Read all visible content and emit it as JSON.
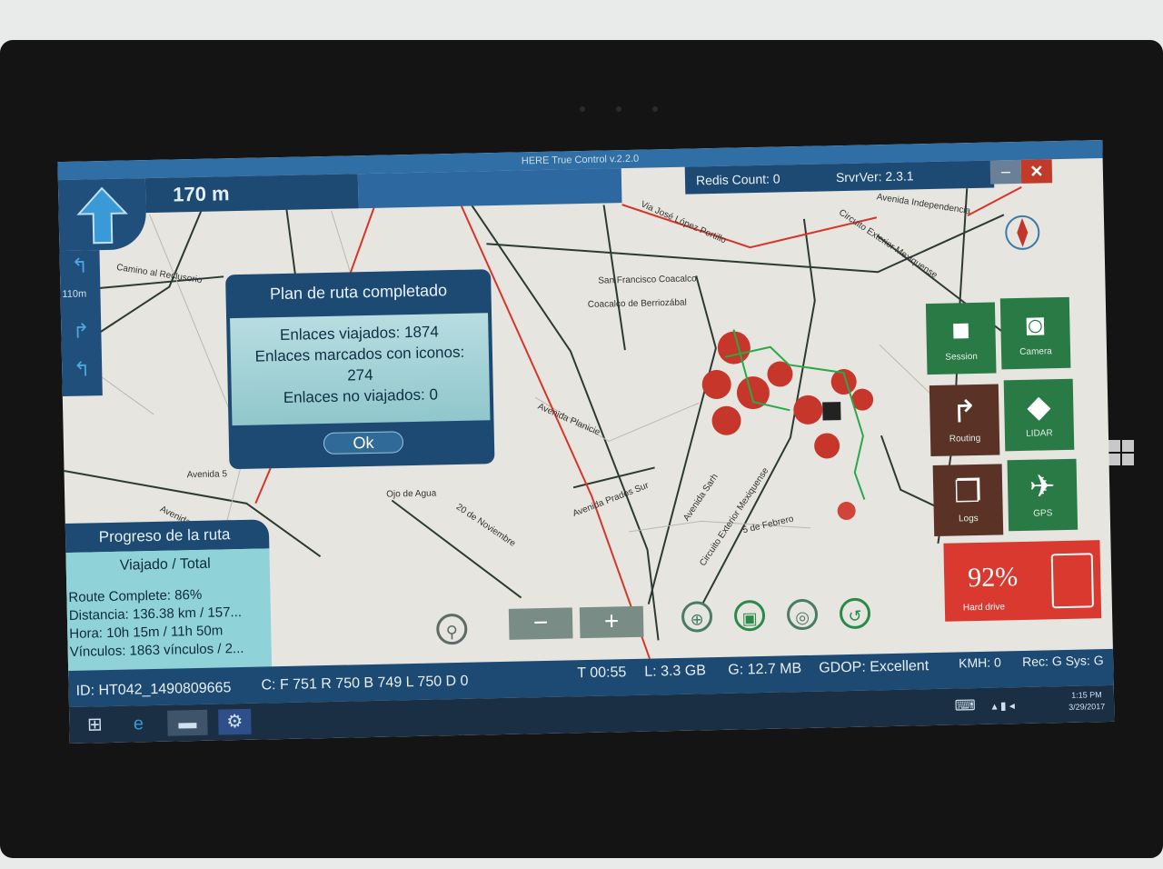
{
  "app": {
    "title": "HERE True Control v.2.2.0"
  },
  "nav": {
    "distance": "170 m",
    "next_distance": "110m"
  },
  "status_top": {
    "redis": "Redis Count: 0",
    "server": "SrvrVer: 2.3.1"
  },
  "map": {
    "labels": [
      "Camino al Reclusorio",
      "Via José López Portillo",
      "Avenida Independencia",
      "Circuito Exterior Mexiquense",
      "San Francisco Coacalco",
      "Coacalco de Berriozábal",
      "Avenida Planicie",
      "Avenida 5",
      "Ojo de Agua",
      "20 de Noviembre",
      "Avenida Prados Sur",
      "Avenida Sarh",
      "Circuito Exterior Mexiquense",
      "5 de Febrero",
      "Avenida"
    ]
  },
  "dialog": {
    "title": "Plan de ruta completado",
    "line1": "Enlaces viajados: 1874",
    "line2": "Enlaces marcados con iconos:",
    "line3": "274",
    "line4": "Enlaces no viajados: 0",
    "ok_label": "Ok"
  },
  "progress": {
    "title": "Progreso de la ruta",
    "subtitle": "Viajado / Total",
    "route_complete": "Route Complete: 86%",
    "distance": "Distancia: 136.38 km / 157...",
    "hours": "Hora: 10h 15m / 11h 50m",
    "links": "Vínculos: 1863 vínculos / 2..."
  },
  "tiles": {
    "session": "Session",
    "camera": "Camera",
    "routing": "Routing",
    "lidar": "LIDAR",
    "logs": "Logs",
    "gps": "GPS",
    "hard_drive_pct": "92%",
    "hard_drive": "Hard drive"
  },
  "status_bottom": {
    "id": "ID: HT042_1490809665",
    "counts": "C: F 751 R 750 B 749 L 750 D 0",
    "time": "T 00:55",
    "l": "L:  3.3 GB",
    "g": "G:  12.7 MB",
    "gdop": "GDOP: Excellent",
    "kmh": "KMH: 0",
    "rec": "Rec: G  Sys: G"
  },
  "taskbar": {
    "clock_time": "1:15 PM",
    "clock_date": "3/29/2017"
  },
  "colors": {
    "panel": "#1d4a73",
    "accent": "#2f6fa5",
    "green_tile": "#2a7a46",
    "brown_tile": "#5a3326",
    "red_tile": "#d9392f"
  }
}
